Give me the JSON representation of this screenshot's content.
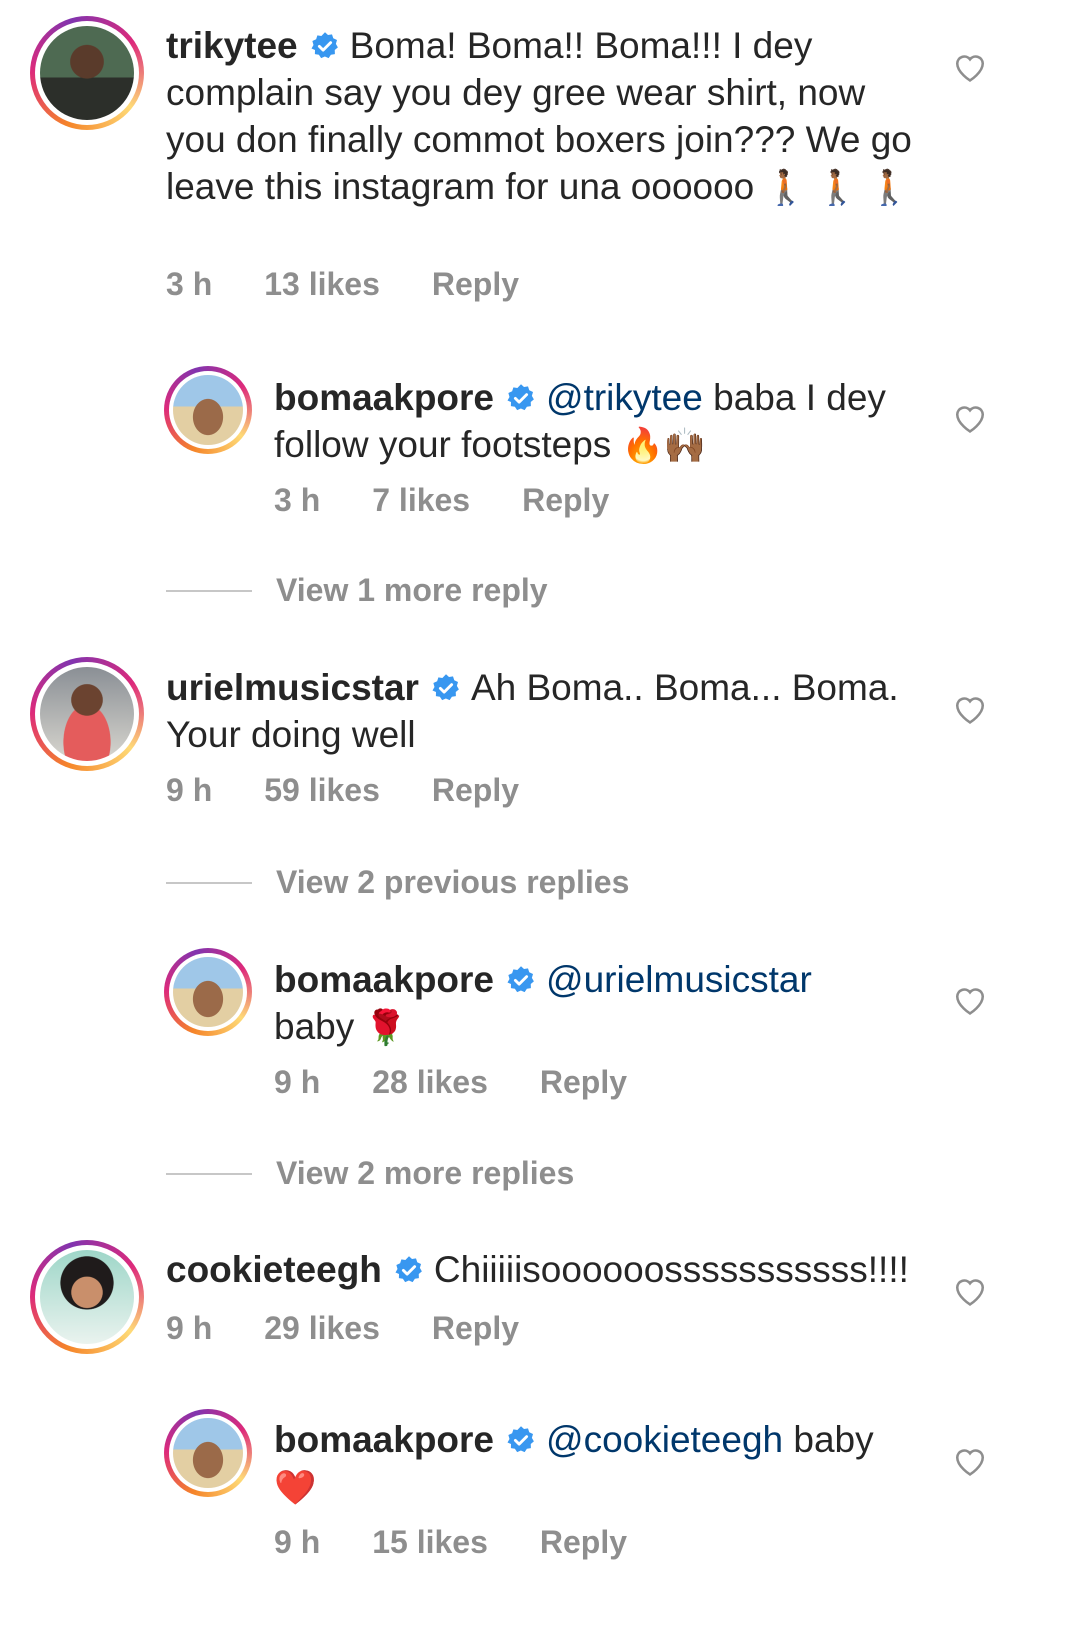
{
  "comments": [
    {
      "username": "trikytee",
      "text": "Boma! Boma!! Boma!!! I dey complain say you dey gree wear shirt, now you don finally commot boxers join??? We go leave this instagram for una oooooo",
      "emoji": "🚶🏾 🚶🏾 🚶🏾",
      "time": "3 h",
      "likes": "13 likes",
      "reply": "Reply",
      "avatar": "avatar-trikytee"
    },
    {
      "username": "bomaakpore",
      "mention": "@trikytee",
      "text": "baba I dey follow your footsteps",
      "emoji": "🔥🙌🏾",
      "time": "3 h",
      "likes": "7 likes",
      "reply": "Reply",
      "avatar": "avatar-bomaakpore"
    },
    {
      "view_more": "View 1 more reply"
    },
    {
      "username": "urielmusicstar",
      "text": "Ah Boma.. Boma... Boma. Your doing well",
      "time": "9 h",
      "likes": "59 likes",
      "reply": "Reply",
      "avatar": "avatar-urielmusicstar"
    },
    {
      "view_more": "View 2 previous replies"
    },
    {
      "username": "bomaakpore",
      "mention": "@urielmusicstar",
      "text": "baby",
      "emoji": "🌹",
      "time": "9 h",
      "likes": "28 likes",
      "reply": "Reply",
      "avatar": "avatar-bomaakpore"
    },
    {
      "view_more": "View 2 more replies"
    },
    {
      "username": "cookieteegh",
      "text": "Chiiiiisoooooosssssssssss!!!!",
      "time": "9 h",
      "likes": "29 likes",
      "reply": "Reply",
      "avatar": "avatar-cookieteegh"
    },
    {
      "username": "bomaakpore",
      "mention": "@cookieteegh",
      "text": "baby",
      "emoji": "❤️",
      "time": "9 h",
      "likes": "15 likes",
      "reply": "Reply",
      "avatar": "avatar-bomaakpore"
    }
  ],
  "colors": {
    "text": "#262626",
    "secondary": "#8e8e8e",
    "mention": "#00376b",
    "verified": "#3897f0"
  },
  "icons": {
    "verified": "verified-badge-icon",
    "like": "heart-outline-icon"
  }
}
